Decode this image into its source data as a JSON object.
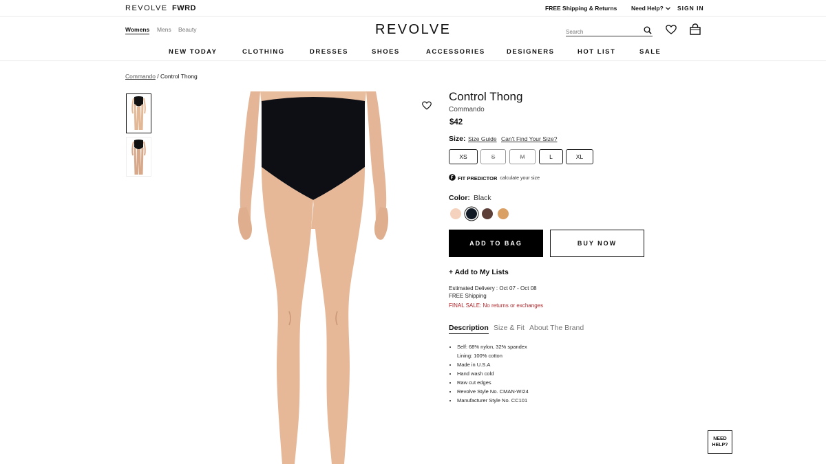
{
  "topbar": {
    "brand": "REVOLVE",
    "sister_brand": "FWRD",
    "shipping": "FREE Shipping & Returns",
    "help": "Need Help?",
    "sign_in": "SIGN IN"
  },
  "header": {
    "genders": [
      "Womens",
      "Mens",
      "Beauty"
    ],
    "logo": "REVOLVE",
    "search_placeholder": "Search",
    "nav": [
      "NEW TODAY",
      "CLOTHING",
      "DRESSES",
      "SHOES",
      "ACCESSORIES",
      "DESIGNERS",
      "HOT LIST",
      "SALE"
    ]
  },
  "breadcrumb": {
    "designer": "Commando",
    "sep": " / ",
    "product": "Control Thong"
  },
  "product": {
    "title": "Control Thong",
    "designer": "Commando",
    "price": "$42",
    "size_label": "Size:",
    "size_guide": "Size Guide",
    "cant_find": "Can't Find Your Size?",
    "sizes": [
      {
        "label": "XS",
        "available": true
      },
      {
        "label": "S",
        "available": false
      },
      {
        "label": "M",
        "available": false
      },
      {
        "label": "L",
        "available": true
      },
      {
        "label": "XL",
        "available": true
      }
    ],
    "fit_predictor": "FIT PREDICTOR",
    "fit_sub": "calculate your size",
    "color_label": "Color:",
    "color_value": "Black",
    "swatches": [
      "#f5d2bd",
      "#121a26",
      "#5c4038",
      "#d99f63"
    ],
    "add_to_bag": "ADD TO BAG",
    "buy_now": "BUY NOW",
    "add_to_lists": "+ Add to My Lists",
    "delivery": "Estimated Delivery : Oct 07 - Oct 08",
    "free_shipping": "FREE Shipping",
    "final_sale": "FINAL SALE: No returns or exchanges",
    "tabs": [
      "Description",
      "Size & Fit",
      "About The Brand"
    ],
    "details": [
      "Self: 68% nylon, 32% spandex",
      "Lining: 100% cotton",
      "Made in U.S.A",
      "Hand wash cold",
      "Raw cut edges",
      "Revolve Style No. CMAN-WI24",
      "Manufacturer Style No. CC101"
    ]
  },
  "chat": {
    "label": "NEED HELP?"
  }
}
